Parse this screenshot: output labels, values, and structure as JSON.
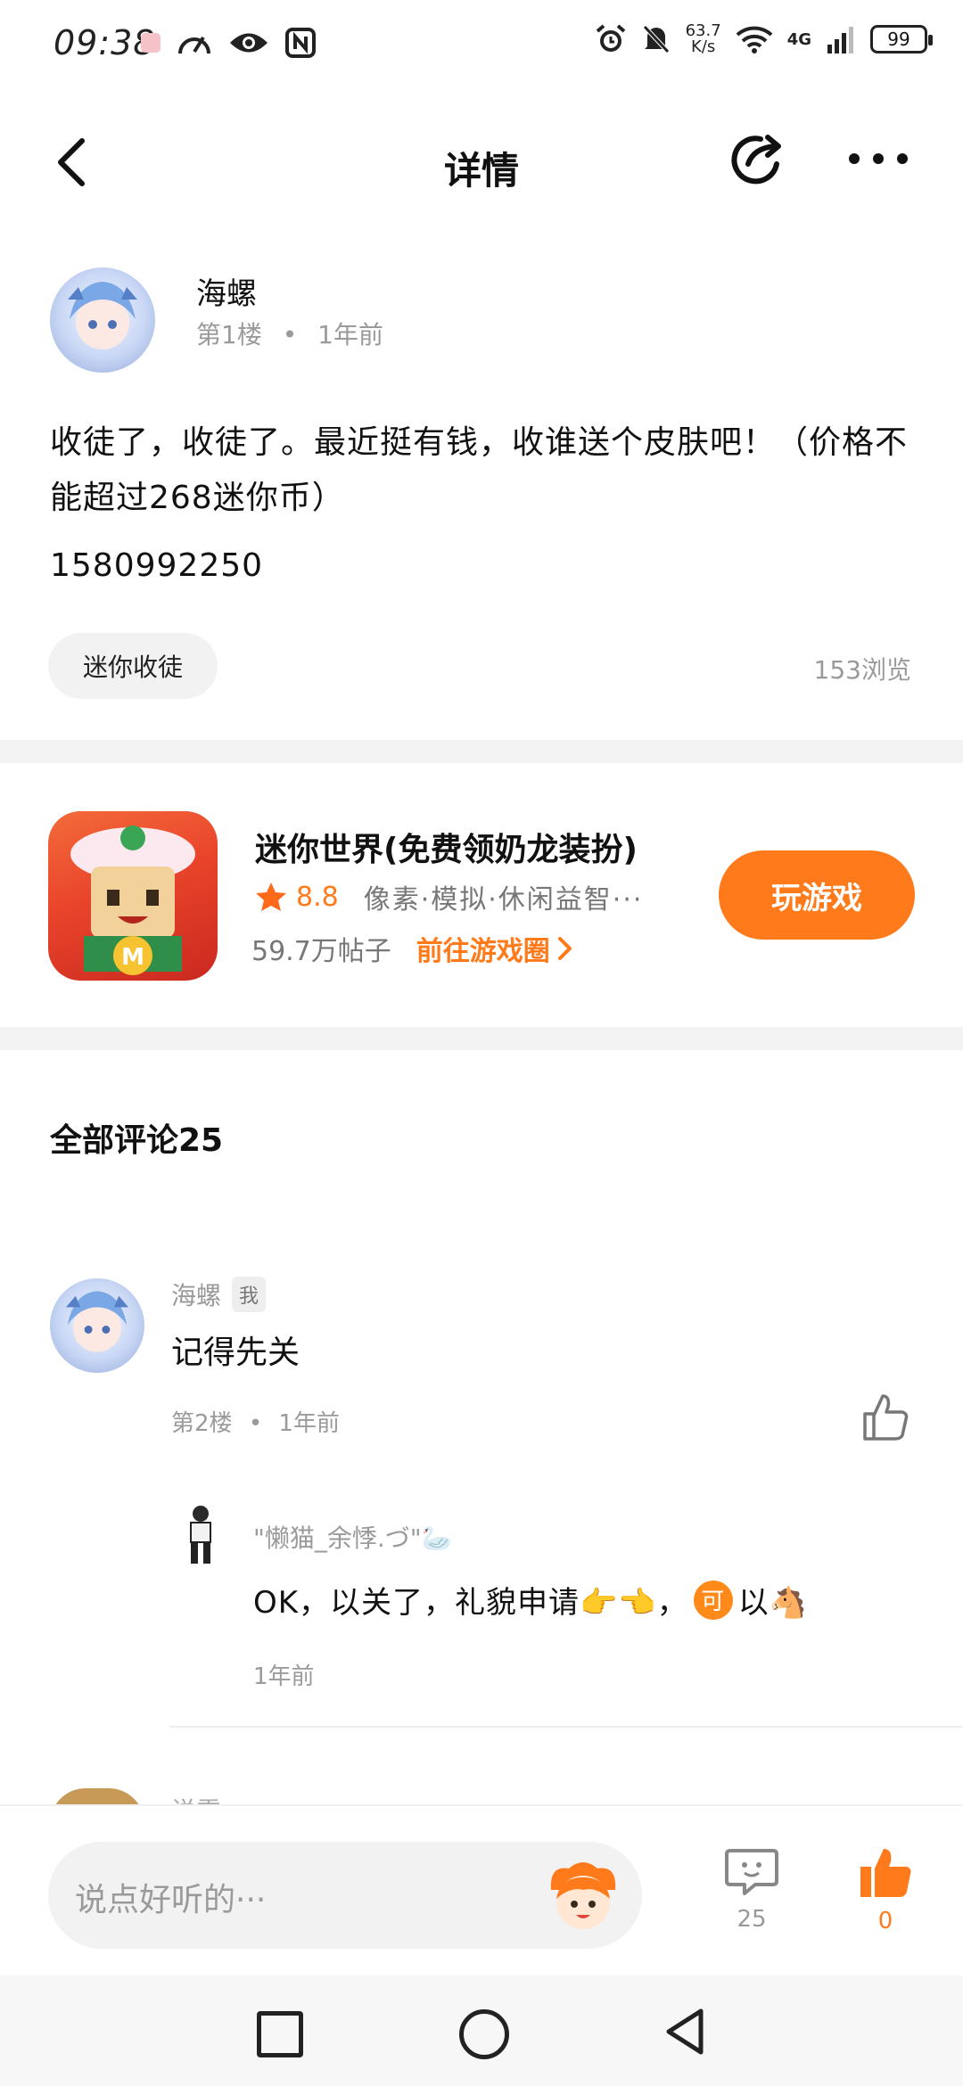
{
  "status_bar": {
    "time": "09:38",
    "net_speed_value": "63.7",
    "net_speed_unit": "K/s",
    "network": "4G",
    "battery": "99"
  },
  "header": {
    "title": "详情"
  },
  "post": {
    "author": "海螺",
    "floor": "第1楼",
    "separator": "•",
    "time_ago": "1年前",
    "body": "收徒了，收徒了。最近挺有钱，收谁送个皮肤吧！（价格不能超过268迷你币）",
    "phone": "1580992250",
    "tag": "迷你收徒",
    "views": "153浏览"
  },
  "game": {
    "name": "迷你世界(免费领奶龙装扮)",
    "rating": "8.8",
    "tags": "像素·模拟·休闲益智···",
    "posts": "59.7万帖子",
    "link_label": "前往游戏圈",
    "play_label": "玩游戏"
  },
  "comments": {
    "header": "全部评论25",
    "items": [
      {
        "author": "海螺",
        "badge": "我",
        "text": "记得先关",
        "floor": "第2楼",
        "separator": "•",
        "time_ago": "1年前",
        "reply": {
          "author": "\"懒猫_余悸.づ\"🦢",
          "text_before": "OK，以关了，礼貌申请👉👈，",
          "emoji_badge": "可",
          "text_after": "以🐴",
          "time_ago": "1年前"
        }
      },
      {
        "author": "说雪"
      }
    ]
  },
  "bottom_bar": {
    "placeholder": "说点好听的···",
    "comment_count": "25",
    "like_count": "0"
  },
  "colors": {
    "accent": "#ff7a1a",
    "muted_text": "#9a9a9a",
    "divider": "#f3f3f3"
  }
}
